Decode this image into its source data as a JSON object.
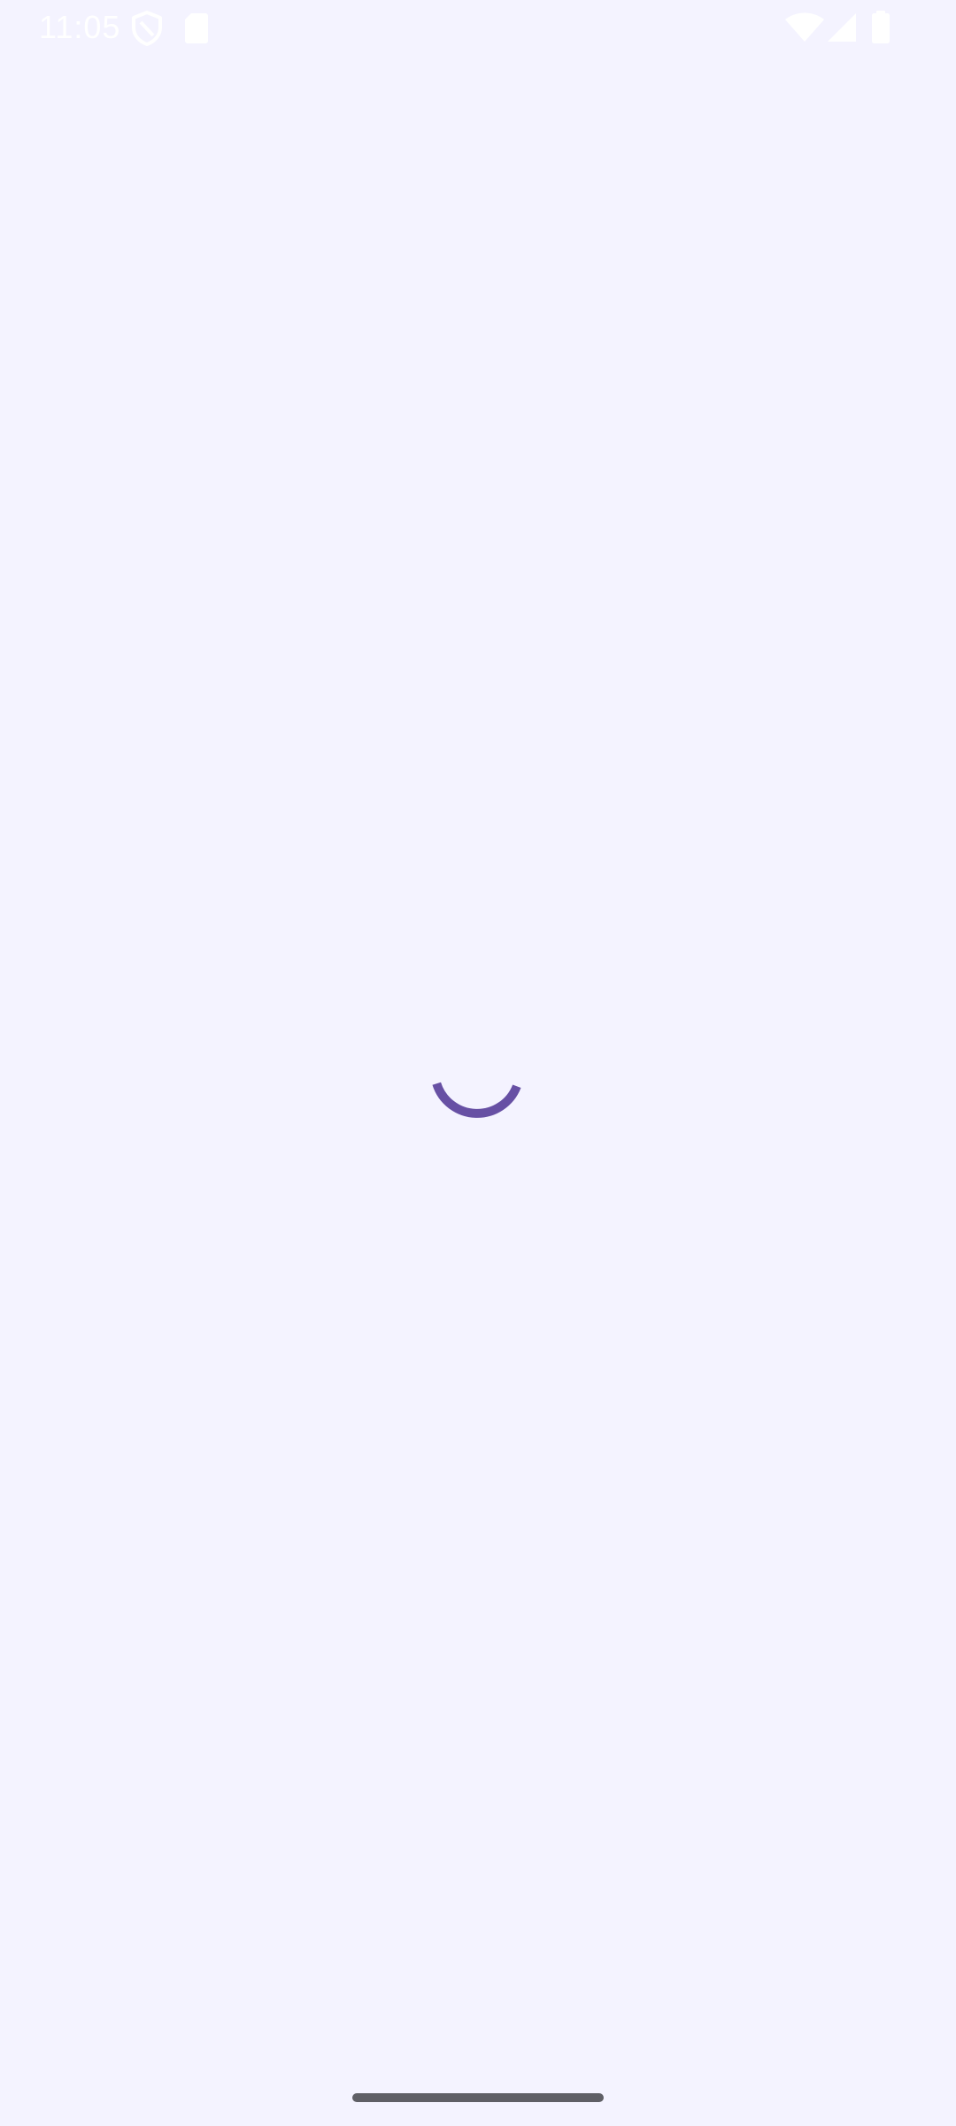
{
  "status_bar": {
    "time": "11:05",
    "icons": [
      "shield-icon",
      "sd-card-icon",
      "wifi-icon",
      "cellular-signal-icon",
      "battery-icon"
    ]
  },
  "main": {
    "state": "loading",
    "accent_color": "#6750a4",
    "background_color": "#f4f3ff"
  }
}
